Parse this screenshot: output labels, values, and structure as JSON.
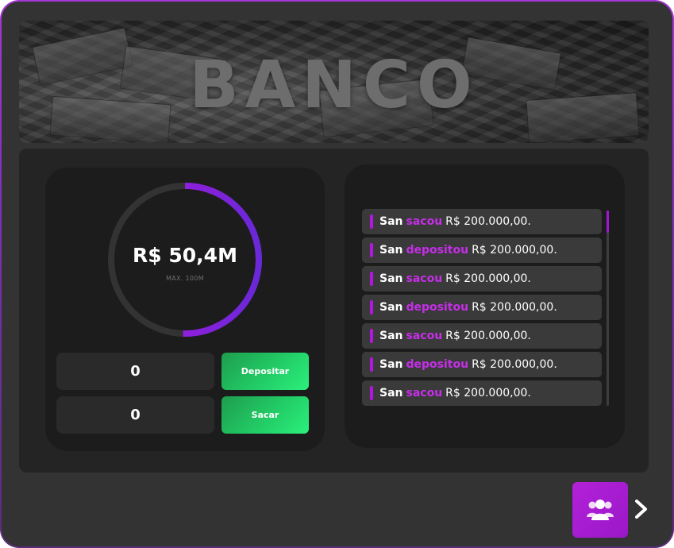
{
  "banner": {
    "title": "BANCO"
  },
  "balance": {
    "value": "R$ 50,4M",
    "max_label": "MAX. 100M",
    "fill_fraction": 0.504
  },
  "deposit": {
    "input_value": "0",
    "button_label": "Depositar"
  },
  "withdraw": {
    "input_value": "0",
    "button_label": "Sacar"
  },
  "log": {
    "items": [
      {
        "name": "San",
        "action": "sacou",
        "amount": "R$ 200.000,00."
      },
      {
        "name": "San",
        "action": "depositou",
        "amount": "R$ 200.000,00."
      },
      {
        "name": "San",
        "action": "sacou",
        "amount": "R$ 200.000,00."
      },
      {
        "name": "San",
        "action": "depositou",
        "amount": "R$ 200.000,00."
      },
      {
        "name": "San",
        "action": "sacou",
        "amount": "R$ 200.000,00."
      },
      {
        "name": "San",
        "action": "depositou",
        "amount": "R$ 200.000,00."
      },
      {
        "name": "San",
        "action": "sacou",
        "amount": "R$ 200.000,00."
      }
    ]
  },
  "icons": {
    "group": "users-group-icon",
    "next": "chevron-right-icon"
  },
  "colors": {
    "accent": "#b316e0",
    "success": "#22cc66",
    "panel": "#333333"
  }
}
